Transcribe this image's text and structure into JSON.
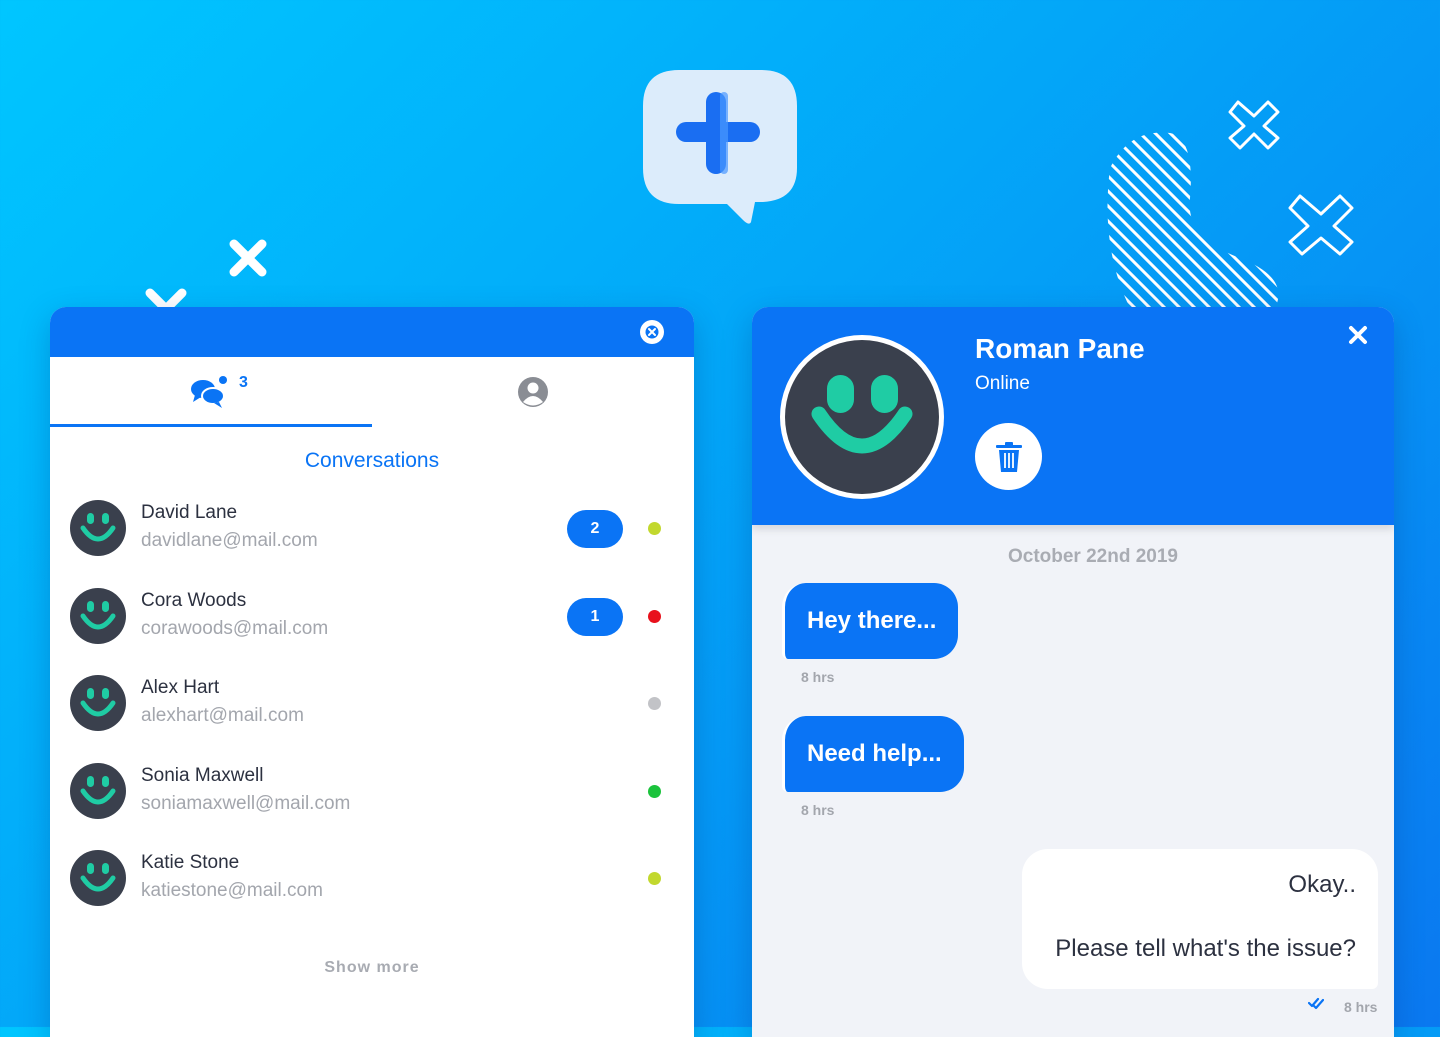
{
  "colors": {
    "brand": "#0a74f5",
    "background_gradient": [
      "#00c6ff",
      "#0a78f0"
    ],
    "status_yellow": "#c2d82e",
    "status_red": "#e8111c",
    "status_grey": "#c2c3c7",
    "status_green": "#1bc33c",
    "avatar_dark": "#3a404d",
    "avatar_teal": "#1fcca4"
  },
  "logo": {
    "icon": "chat-plus-icon"
  },
  "left_panel": {
    "close_icon": "close-circle-icon",
    "tabs": [
      {
        "name": "conversations",
        "icon": "chat-bubbles-icon",
        "count": "3",
        "active": true
      },
      {
        "name": "profile",
        "icon": "user-circle-icon",
        "active": false
      }
    ],
    "section_title": "Conversations",
    "conversations": [
      {
        "name": "David Lane",
        "email": "davidlane@mail.com",
        "unread": "2",
        "status": "status_yellow"
      },
      {
        "name": "Cora Woods",
        "email": "corawoods@mail.com",
        "unread": "1",
        "status": "status_red"
      },
      {
        "name": "Alex Hart",
        "email": "alexhart@mail.com",
        "unread": "",
        "status": "status_grey"
      },
      {
        "name": "Sonia Maxwell",
        "email": "soniamaxwell@mail.com",
        "unread": "",
        "status": "status_green"
      },
      {
        "name": "Katie Stone",
        "email": "katiestone@mail.com",
        "unread": "",
        "status": "status_yellow"
      }
    ],
    "show_more": "Show more"
  },
  "right_panel": {
    "contact_name": "Roman Pane",
    "contact_status": "Online",
    "delete_icon": "trash-icon",
    "close_icon": "close-icon",
    "date_separator": "October 22nd 2019",
    "messages": [
      {
        "direction": "in",
        "text": "Hey there...",
        "time": "8 hrs"
      },
      {
        "direction": "in",
        "text": "Need help...",
        "time": "8 hrs"
      },
      {
        "direction": "out",
        "lines": [
          "Okay..",
          "Please tell what's the issue?"
        ],
        "time": "8 hrs",
        "read_icon": "double-check-icon"
      }
    ]
  }
}
